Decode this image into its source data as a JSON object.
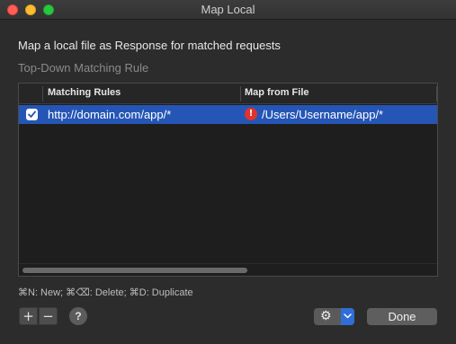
{
  "window": {
    "title": "Map Local"
  },
  "heading": "Map a local file as Response for matched requests",
  "subheading": "Top-Down Matching Rule",
  "table": {
    "columns": [
      "Matching Rules",
      "Map from File"
    ],
    "rows": [
      {
        "enabled": true,
        "rule": "http://domain.com/app/*",
        "file": "/Users/Username/app/*",
        "file_status_icon": "error-icon",
        "selected": true
      }
    ]
  },
  "shortcuts": "⌘N: New; ⌘⌫: Delete; ⌘D: Duplicate",
  "footer": {
    "add_label": "+",
    "remove_label": "−",
    "help_label": "?",
    "settings_icon": "gear-icon",
    "done_label": "Done"
  },
  "colors": {
    "selection": "#2556b6",
    "error": "#e0332d",
    "accent": "#2f6ed8"
  }
}
